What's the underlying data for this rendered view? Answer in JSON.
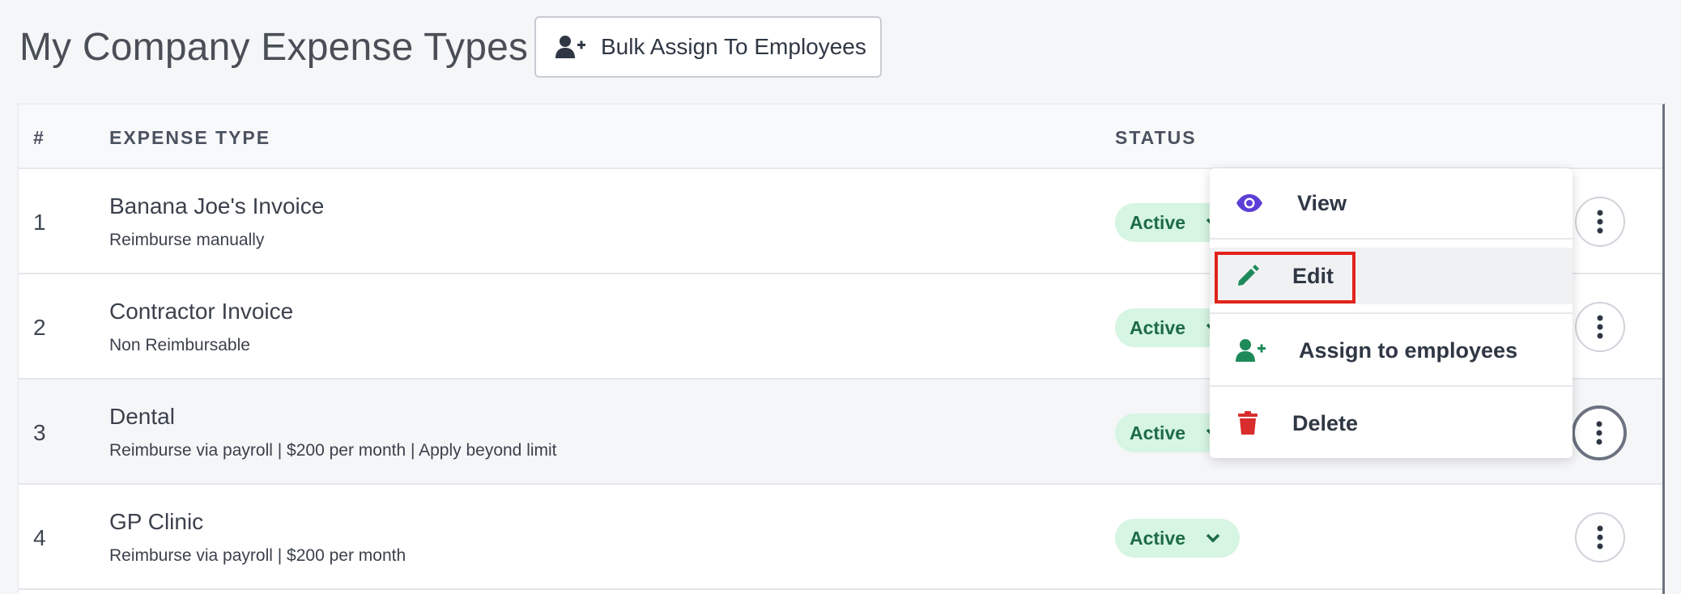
{
  "header": {
    "title": "My Company Expense Types",
    "bulk_button_label": "Bulk Assign To Employees"
  },
  "table": {
    "columns": [
      "#",
      "EXPENSE TYPE",
      "STATUS"
    ],
    "rows": [
      {
        "num": "1",
        "name": "Banana Joe's Invoice",
        "desc": "Reimburse manually",
        "status": "Active"
      },
      {
        "num": "2",
        "name": "Contractor Invoice",
        "desc": "Non Reimbursable",
        "status": "Active"
      },
      {
        "num": "3",
        "name": "Dental",
        "desc": "Reimburse via payroll | $200 per month | Apply beyond limit",
        "status": "Active"
      },
      {
        "num": "4",
        "name": "GP Clinic",
        "desc": "Reimburse via payroll | $200 per month",
        "status": "Active"
      }
    ]
  },
  "menu": {
    "items": [
      {
        "label": "View",
        "icon": "eye-icon",
        "color": "#5b3fd6"
      },
      {
        "label": "Edit",
        "icon": "pencil-icon",
        "color": "#1e8a5a"
      },
      {
        "label": "Assign to employees",
        "icon": "user-plus-icon",
        "color": "#1e8a5a"
      },
      {
        "label": "Delete",
        "icon": "trash-icon",
        "color": "#d92c2c"
      }
    ]
  },
  "colors": {
    "status_bg": "#d6f5e2",
    "status_text": "#1d6b45",
    "highlight": "#e2231a"
  }
}
